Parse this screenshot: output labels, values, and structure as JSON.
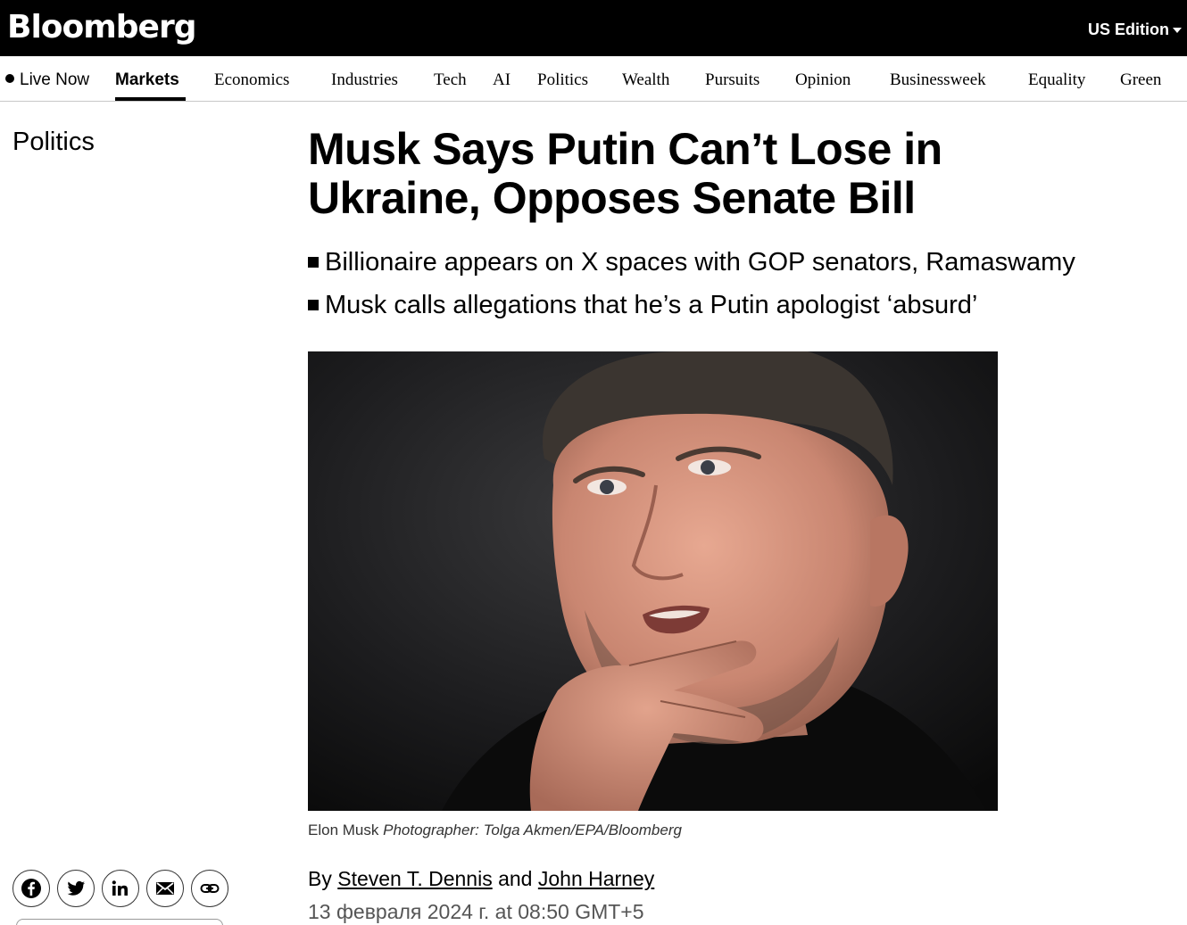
{
  "header": {
    "logo": "Bloomberg",
    "edition": "US Edition"
  },
  "nav": {
    "items": [
      {
        "label": "Live Now"
      },
      {
        "label": "Markets"
      },
      {
        "label": "Economics"
      },
      {
        "label": "Industries"
      },
      {
        "label": "Tech"
      },
      {
        "label": "AI"
      },
      {
        "label": "Politics"
      },
      {
        "label": "Wealth"
      },
      {
        "label": "Pursuits"
      },
      {
        "label": "Opinion"
      },
      {
        "label": "Businessweek"
      },
      {
        "label": "Equality"
      },
      {
        "label": "Green"
      }
    ],
    "active": "Markets"
  },
  "article": {
    "section": "Politics",
    "headline": "Musk Says Putin Can’t Lose in Ukraine, Opposes Senate Bill",
    "bullets": [
      "Billionaire appears on X spaces with GOP senators, Ramaswamy",
      "Musk calls allegations that he’s a Putin apologist ‘absurd’"
    ],
    "caption": {
      "subject": "Elon Musk",
      "credit": "Photographer: Tolga Akmen/EPA/Bloomberg"
    },
    "byline": {
      "prefix": "By",
      "author1": "Steven T. Dennis",
      "conjunction": "and",
      "author2": "John Harney"
    },
    "date": "13 февраля 2024 г. at 08:50 GMT+5"
  },
  "share": {
    "icons": [
      "facebook-icon",
      "twitter-icon",
      "linkedin-icon",
      "email-icon",
      "link-icon"
    ]
  },
  "colors": {
    "topbar_bg": "#000000",
    "text": "#000000",
    "divider": "#c8c8c8"
  }
}
